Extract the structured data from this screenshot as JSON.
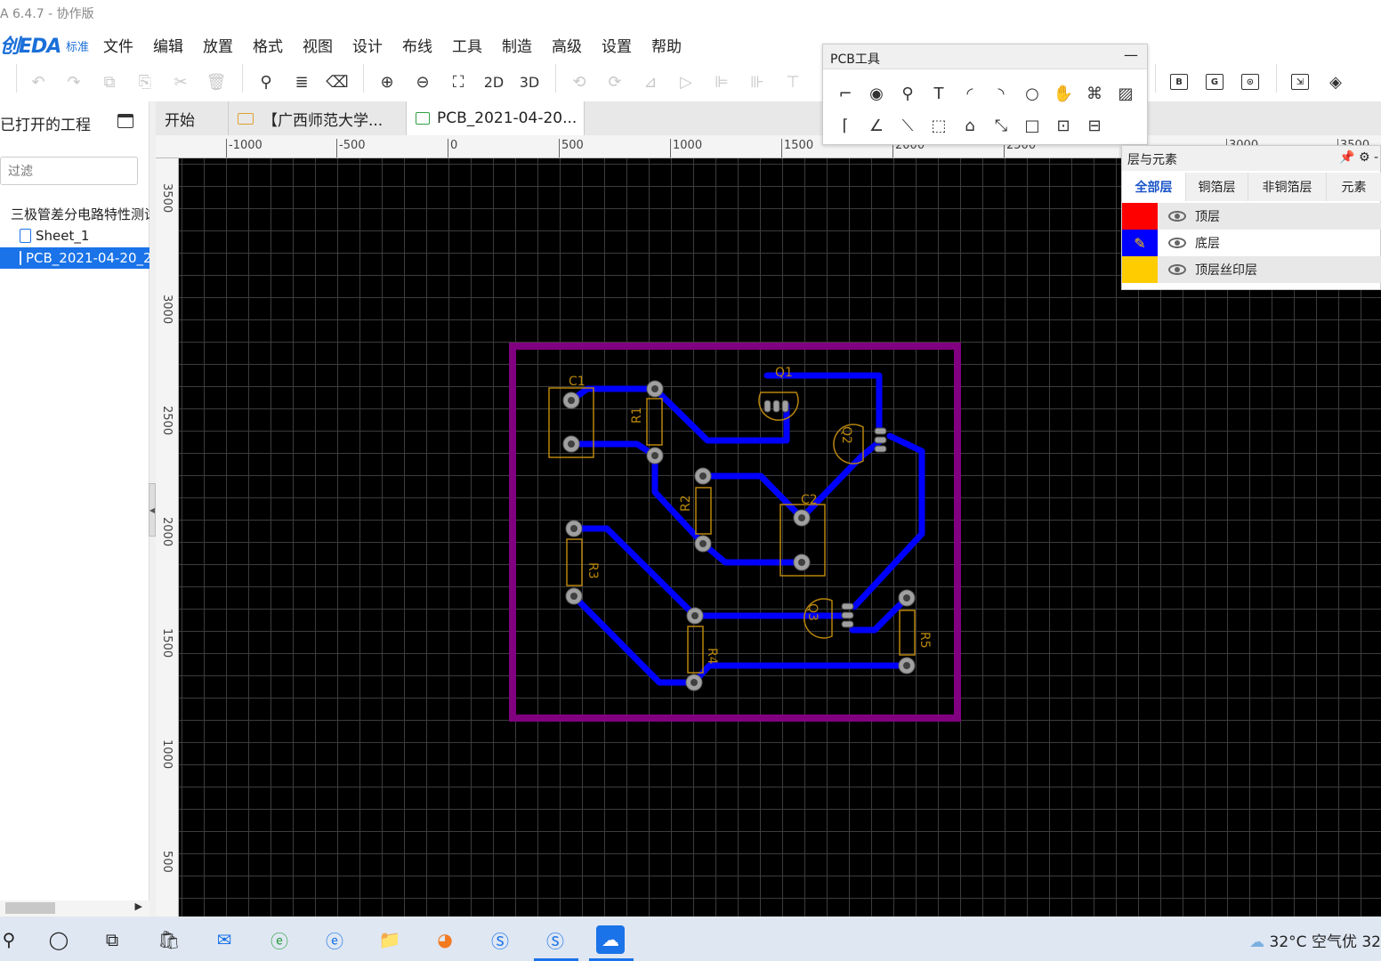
{
  "app": {
    "title": "A 6.4.7 - 协作版",
    "logo": "创EDA",
    "edition": "标准"
  },
  "menu": [
    "文件",
    "编辑",
    "放置",
    "格式",
    "视图",
    "设计",
    "布线",
    "工具",
    "制造",
    "高级",
    "设置",
    "帮助"
  ],
  "toolbar": {
    "btn_2d": "2D",
    "btn_3d": "3D",
    "btn_b": "B",
    "btn_g": "G"
  },
  "left_panel": {
    "header": "已打开的工程",
    "filter_placeholder": "过滤",
    "tree": [
      {
        "label": "三极管差分电路特性测试"
      },
      {
        "label": "Sheet_1"
      },
      {
        "label": "PCB_2021-04-20_2"
      }
    ]
  },
  "tabs": [
    {
      "label": "开始"
    },
    {
      "label": "【广西师范大学..."
    },
    {
      "label": "PCB_2021-04-20..."
    }
  ],
  "ruler": {
    "top": [
      "-1000",
      "-500",
      "0",
      "500",
      "1000",
      "1500",
      "2000",
      "2500",
      "3000",
      "3500"
    ],
    "left": [
      "3500",
      "3000",
      "2500",
      "2000",
      "1500",
      "1000",
      "500"
    ]
  },
  "pcb_tools": {
    "title": "PCB工具"
  },
  "layer_panel": {
    "title": "层与元素",
    "tabs": [
      "全部层",
      "铜箔层",
      "非铜箔层",
      "元素"
    ],
    "layers": [
      {
        "name": "顶层",
        "color": "#ff0000"
      },
      {
        "name": "底层",
        "color": "#0000ff"
      },
      {
        "name": "顶层丝印层",
        "color": "#ffcc00"
      }
    ]
  },
  "pcb": {
    "components": [
      "C1",
      "R1",
      "Q1",
      "Q2",
      "R2",
      "C2",
      "R3",
      "Q3",
      "R4",
      "R5"
    ],
    "board_outline_color": "#800080",
    "track_color": "#0000ff",
    "silk_color": "#b8860b"
  },
  "taskbar": {
    "weather": "32°C  空气优 32"
  }
}
